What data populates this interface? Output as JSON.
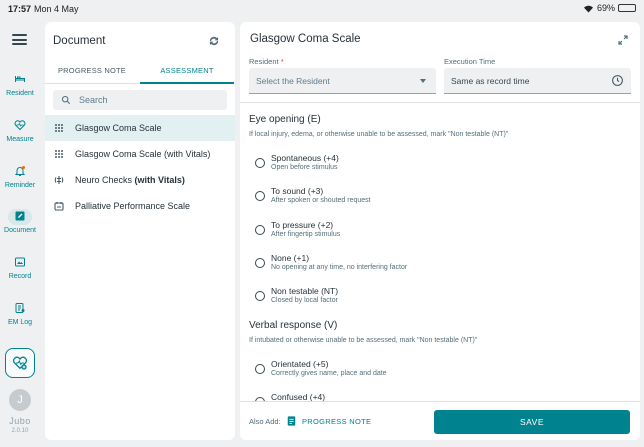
{
  "status_bar": {
    "time": "17:57",
    "date": "Mon 4 May",
    "battery": "69%",
    "battery_level": 0.69
  },
  "rail": {
    "items": [
      {
        "label": "Resident",
        "icon": "bed-icon"
      },
      {
        "label": "Measure",
        "icon": "heart-pulse-icon"
      },
      {
        "label": "Reminder",
        "icon": "bell-icon"
      },
      {
        "label": "Document",
        "icon": "edit-document-icon"
      },
      {
        "label": "Record",
        "icon": "record-icon"
      },
      {
        "label": "EM Log",
        "icon": "log-icon"
      }
    ],
    "avatar_initial": "J",
    "logo": "Jubo",
    "version": "2.0.10"
  },
  "document_panel": {
    "title": "Document",
    "tabs": [
      {
        "label": "PROGRESS NOTE"
      },
      {
        "label": "ASSESSMENT"
      }
    ],
    "active_tab": "ASSESSMENT",
    "search_placeholder": "Search",
    "scales": [
      {
        "label": "Glasgow Coma Scale",
        "suffix": "",
        "selected": true
      },
      {
        "label": "Glasgow Coma Scale (with Vitals)",
        "suffix": "",
        "selected": false
      },
      {
        "label": "Neuro Checks ",
        "suffix": "(with Vitals)",
        "selected": false
      },
      {
        "label": "Palliative Performance Scale",
        "suffix": "",
        "selected": false
      }
    ]
  },
  "form": {
    "title": "Glasgow Coma Scale",
    "resident_label": "Resident",
    "required_mark": "*",
    "resident_placeholder": "Select the Resident",
    "execution_label": "Execution Time",
    "execution_value": "Same as record time",
    "sections": [
      {
        "heading": "Eye opening (E)",
        "description": "If local injury, edema, or otherwise unable to be assessed, mark \"Non testable (NT)\"",
        "options": [
          {
            "label": "Spontaneous (+4)",
            "desc": "Open before stimulus"
          },
          {
            "label": "To sound (+3)",
            "desc": "After spoken or shouted request"
          },
          {
            "label": "To pressure (+2)",
            "desc": "After fingertip stimulus"
          },
          {
            "label": "None (+1)",
            "desc": "No opening at any time, no interfering factor"
          },
          {
            "label": "Non testable (NT)",
            "desc": "Closed by local factor"
          }
        ]
      },
      {
        "heading": "Verbal response (V)",
        "description": "If intubated or otherwise unable to be assessed, mark \"Non testable (NT)\"",
        "options": [
          {
            "label": "Orientated (+5)",
            "desc": "Correctly gives name, place and date"
          },
          {
            "label": "Confused (+4)",
            "desc": ""
          }
        ]
      }
    ],
    "footer": {
      "also_add": "Also Add:",
      "progress_note": "PROGRESS NOTE",
      "save": "SAVE"
    }
  },
  "colors": {
    "accent": "#00838f",
    "selected_bg": "#e3f0f2",
    "required": "#e53935"
  }
}
